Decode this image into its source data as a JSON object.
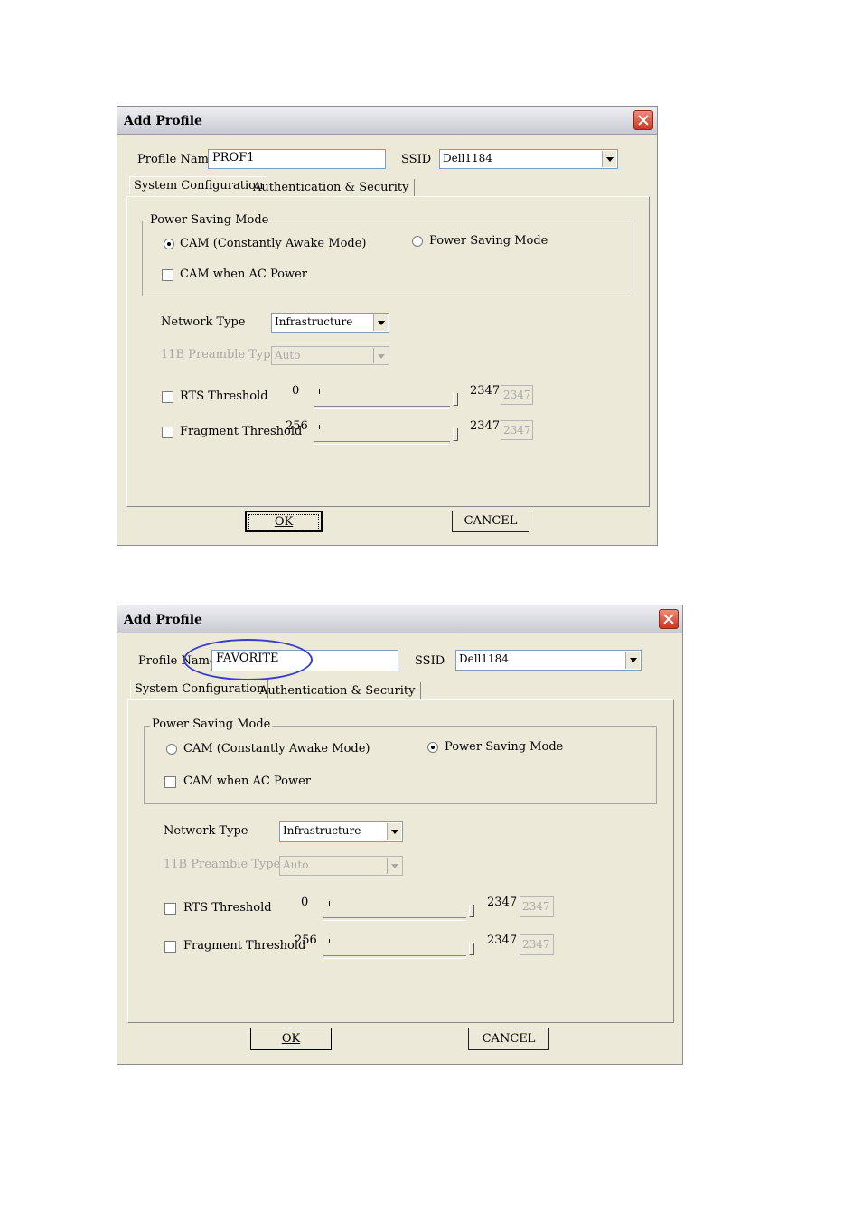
{
  "dialogs": [
    {
      "title": "Add Profile",
      "profile_name_label": "Profile Name",
      "profile_name_value": "PROF1",
      "ssid_label": "SSID",
      "ssid_value": "Dell1184",
      "tabs": [
        {
          "label": "System Configuration",
          "active": true
        },
        {
          "label": "Authentication & Security",
          "active": false
        }
      ],
      "power_saving_group_label": "Power Saving Mode",
      "radio_cam_label": "CAM (Constantly Awake Mode)",
      "radio_cam_selected": true,
      "radio_psm_label": "Power Saving Mode",
      "radio_psm_selected": false,
      "check_cam_ac_label": "CAM when AC Power",
      "network_type_label": "Network Type",
      "network_type_value": "Infrastructure",
      "preamble_label": "11B Preamble Type",
      "preamble_value": "Auto",
      "rts_label": "RTS Threshold",
      "rts_min": "0",
      "rts_max": "2347",
      "rts_value": "2347",
      "frag_label": "Fragment Threshold",
      "frag_min": "256",
      "frag_max": "2347",
      "frag_value": "2347",
      "ok_label": "OK",
      "cancel_label": "CANCEL"
    },
    {
      "title": "Add Profile",
      "profile_name_label": "Profile Name",
      "profile_name_value": "FAVORITE",
      "ssid_label": "SSID",
      "ssid_value": "Dell1184",
      "tabs": [
        {
          "label": "System Configuration",
          "active": true
        },
        {
          "label": "Authentication & Security",
          "active": false
        }
      ],
      "power_saving_group_label": "Power Saving Mode",
      "radio_cam_label": "CAM (Constantly Awake Mode)",
      "radio_cam_selected": false,
      "radio_psm_label": "Power Saving Mode",
      "radio_psm_selected": true,
      "check_cam_ac_label": "CAM when AC Power",
      "network_type_label": "Network Type",
      "network_type_value": "Infrastructure",
      "preamble_label": "11B Preamble Type",
      "preamble_value": "Auto",
      "rts_label": "RTS Threshold",
      "rts_min": "0",
      "rts_max": "2347",
      "rts_value": "2347",
      "frag_label": "Fragment Threshold",
      "frag_min": "256",
      "frag_max": "2347",
      "frag_value": "2347",
      "ok_label": "OK",
      "cancel_label": "CANCEL"
    }
  ],
  "colors": {
    "dialog_bg": "#ece9d8",
    "close_button": "#d9482e",
    "highlight_oval": "#3a3ad0"
  }
}
